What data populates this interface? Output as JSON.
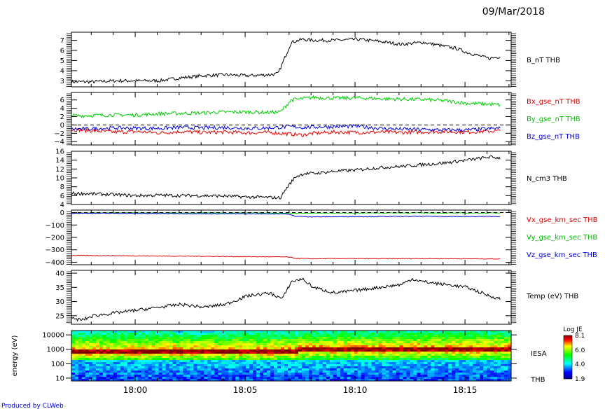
{
  "header": {
    "date": "09/Mar/2018"
  },
  "footer": {
    "credit": "Produced by CLWeb"
  },
  "time_axis": {
    "tick_labels": [
      "18:00",
      "18:05",
      "18:10",
      "18:15"
    ],
    "range_min": [
      17.3,
      17.3
    ]
  },
  "chart_data": [
    {
      "type": "line",
      "id": "p1",
      "ylim": [
        2.4,
        7.8
      ],
      "yticks": [
        "3",
        "4",
        "5",
        "6",
        "7"
      ],
      "ytick_values": [
        3,
        4,
        5,
        6,
        7
      ],
      "series": [
        {
          "name": "B_nT THB",
          "color": "#000000",
          "x": [
            0,
            1,
            2,
            3,
            4,
            5,
            6,
            7,
            8,
            9,
            9.4,
            10,
            10.5,
            11,
            12,
            13,
            14,
            15,
            16,
            17,
            17.5,
            18,
            19,
            19.5
          ],
          "y": [
            2.9,
            2.9,
            3.0,
            3.0,
            3.0,
            3.3,
            3.5,
            3.6,
            3.5,
            3.6,
            3.7,
            6.8,
            7.1,
            7.0,
            7.0,
            7.1,
            6.9,
            6.6,
            6.8,
            6.4,
            6.2,
            5.8,
            5.2,
            5.4
          ]
        }
      ]
    },
    {
      "type": "line",
      "id": "p2",
      "ylim": [
        -4.8,
        7.8
      ],
      "yticks": [
        "−4",
        "−2",
        "0",
        "2",
        "4",
        "6"
      ],
      "ytick_values": [
        -4,
        -2,
        0,
        2,
        4,
        6
      ],
      "zero_line": true,
      "series": [
        {
          "name": "Bx_gse_nT THB",
          "color": "#e00000",
          "x": [
            0,
            1,
            2,
            3,
            4,
            5,
            6,
            7,
            8,
            9,
            10,
            10.5,
            11,
            12,
            13,
            14,
            15,
            16,
            17,
            18,
            19,
            19.5
          ],
          "y": [
            -1.1,
            -1.4,
            -1.7,
            -1.6,
            -1.9,
            -1.6,
            -1.8,
            -1.7,
            -1.9,
            -1.8,
            -2.2,
            -2.4,
            -2.0,
            -1.7,
            -1.8,
            -1.7,
            -1.8,
            -1.7,
            -1.6,
            -1.7,
            -1.5,
            -1.4
          ]
        },
        {
          "name": "By_gse_nT THB",
          "color": "#00cc00",
          "x": [
            0,
            1,
            2,
            3,
            4,
            5,
            6,
            7,
            8,
            9,
            9.5,
            10,
            10.5,
            11,
            12,
            13,
            14,
            15,
            16,
            17,
            18,
            19,
            19.5
          ],
          "y": [
            2.2,
            2.3,
            2.4,
            2.4,
            2.7,
            2.8,
            2.9,
            3.1,
            3.1,
            3.0,
            3.1,
            6.0,
            6.3,
            6.6,
            6.4,
            6.5,
            6.3,
            6.2,
            6.1,
            5.8,
            5.2,
            5.0,
            4.8
          ]
        },
        {
          "name": "Bz_gse_nT THB",
          "color": "#0000dd",
          "x": [
            0,
            1,
            2,
            3,
            4,
            5,
            6,
            7,
            8,
            9,
            10,
            10.5,
            11,
            12,
            13,
            14,
            15,
            16,
            17,
            18,
            19,
            19.5
          ],
          "y": [
            -1.0,
            -0.9,
            -0.7,
            -0.8,
            -0.8,
            -0.6,
            -0.7,
            -0.6,
            -0.8,
            -0.7,
            -0.4,
            -0.6,
            -0.5,
            -0.4,
            -0.3,
            -0.8,
            -1.0,
            -1.1,
            -1.2,
            -1.2,
            -0.9,
            -0.8
          ]
        }
      ]
    },
    {
      "type": "line",
      "id": "p3",
      "ylim": [
        4,
        16
      ],
      "yticks": [
        "4",
        "6",
        "8",
        "10",
        "12",
        "14",
        "16"
      ],
      "ytick_values": [
        4,
        6,
        8,
        10,
        12,
        14,
        16
      ],
      "series": [
        {
          "name": "N_cm3 THB",
          "color": "#000000",
          "x": [
            0,
            1,
            2,
            3,
            4,
            5,
            6,
            7,
            8,
            9,
            9.5,
            9.8,
            10.2,
            10.6,
            11,
            12,
            13,
            14,
            15,
            16,
            17,
            18,
            19,
            19.5
          ],
          "y": [
            6.5,
            6.4,
            6.2,
            6.0,
            6.1,
            6.0,
            6.0,
            5.9,
            5.7,
            5.6,
            5.5,
            7.8,
            10.3,
            11.0,
            11.0,
            11.5,
            11.8,
            12.3,
            12.6,
            13.0,
            13.4,
            14.0,
            14.7,
            14.5
          ]
        }
      ]
    },
    {
      "type": "line",
      "id": "p4",
      "ylim": [
        -420,
        20
      ],
      "yticks": [
        "−400",
        "−300",
        "−200",
        "−100",
        "0"
      ],
      "ytick_values": [
        -400,
        -300,
        -200,
        -100,
        0
      ],
      "zero_line": true,
      "series": [
        {
          "name": "Vx_gse_km_sec THB",
          "color": "#e00000",
          "x": [
            0,
            2,
            4,
            6,
            8,
            9.8,
            10.2,
            11,
            12,
            14,
            16,
            18,
            19.5
          ],
          "y": [
            -345,
            -347,
            -350,
            -352,
            -355,
            -357,
            -368,
            -372,
            -370,
            -371,
            -370,
            -372,
            -373
          ]
        },
        {
          "name": "Vy_gse_km_sec THB",
          "color": "#00cc00",
          "x": [
            0,
            2,
            4,
            6,
            8,
            10,
            12,
            14,
            16,
            18,
            19.5
          ],
          "y": [
            -2,
            -1,
            -2,
            -3,
            -2,
            -5,
            -4,
            -3,
            -3,
            -4,
            -3
          ]
        },
        {
          "name": "Vz_gse_km_sec THB",
          "color": "#0000dd",
          "x": [
            0,
            2,
            4,
            6,
            8,
            9.8,
            10.2,
            11,
            12,
            14,
            16,
            18,
            19.5
          ],
          "y": [
            -5,
            -6,
            -8,
            -9,
            -10,
            -10,
            -30,
            -34,
            -33,
            -32,
            -30,
            -32,
            -31
          ]
        }
      ]
    },
    {
      "type": "line",
      "id": "p5",
      "ylim": [
        22,
        41
      ],
      "yticks": [
        "25",
        "30",
        "35",
        "40"
      ],
      "ytick_values": [
        25,
        30,
        35,
        40
      ],
      "series": [
        {
          "name": "Temp (eV) THB",
          "color": "#000000",
          "x": [
            0,
            0.5,
            1,
            2,
            3,
            4,
            5,
            6,
            7,
            8,
            9,
            9.6,
            10,
            10.5,
            11,
            12,
            13,
            14,
            15,
            15.5,
            16,
            17,
            18,
            19,
            19.5
          ],
          "y": [
            24,
            23.5,
            25,
            26,
            27,
            28,
            29,
            28,
            29,
            32,
            33,
            31,
            37,
            38,
            35,
            33,
            34,
            35,
            36,
            38,
            37,
            36,
            35,
            32,
            31
          ]
        }
      ]
    },
    {
      "type": "heatmap",
      "id": "p6",
      "ylabel": "energy (eV)",
      "yticks": [
        "10",
        "100",
        "1000",
        "10000"
      ],
      "ytick_values": [
        10,
        100,
        1000,
        10000
      ],
      "ylim_log10": [
        0.8,
        4.3
      ],
      "label": "IESA",
      "sublabel": "THB",
      "colorbar": {
        "title": "Log JE",
        "ticks": [
          "8.1",
          "6.0",
          "4.0",
          "1.9"
        ],
        "tick_values": [
          8.1,
          6.0,
          4.0,
          1.9
        ],
        "range": [
          1.9,
          8.1
        ]
      },
      "shift_time": 10.3,
      "band_peak_log10": [
        2.83,
        2.98
      ],
      "band_peak_value": 8.0
    }
  ]
}
